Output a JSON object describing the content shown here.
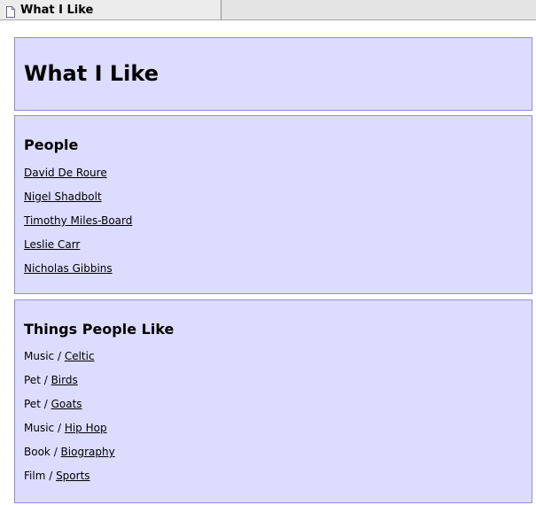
{
  "tab": {
    "title": "What I Like"
  },
  "page": {
    "title": "What I Like"
  },
  "people": {
    "title": "People",
    "items": [
      "David De Roure",
      "Nigel Shadbolt",
      "Timothy Miles-Board",
      "Leslie Carr",
      "Nicholas Gibbins"
    ]
  },
  "things": {
    "title": "Things People Like",
    "separator": " / ",
    "items": [
      {
        "category": "Music",
        "value": "Celtic"
      },
      {
        "category": "Pet",
        "value": "Birds"
      },
      {
        "category": "Pet",
        "value": "Goats"
      },
      {
        "category": "Music",
        "value": "Hip Hop"
      },
      {
        "category": "Book",
        "value": "Biography"
      },
      {
        "category": "Film",
        "value": "Sports"
      }
    ]
  }
}
